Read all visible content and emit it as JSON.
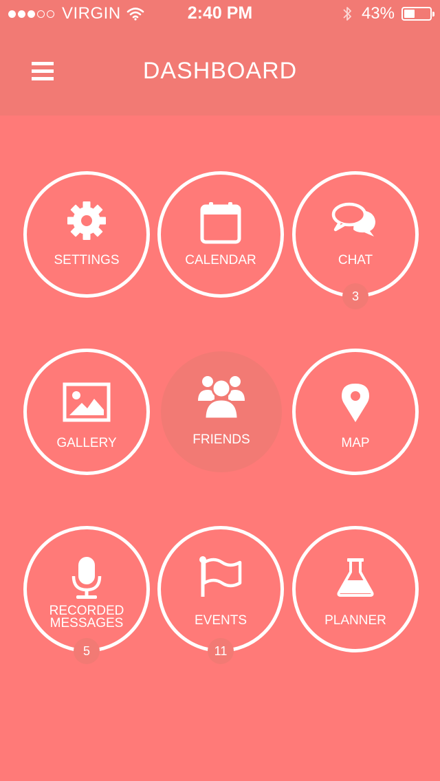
{
  "status_bar": {
    "carrier": "VIRGIN",
    "time": "2:40 PM",
    "battery_percent": "43%",
    "battery_level": 0.43,
    "signal_bars": 3
  },
  "header": {
    "title": "DASHBOARD",
    "menu_icon": "hamburger-menu-icon"
  },
  "colors": {
    "background": "#ff7a78",
    "header": "#f27a74",
    "badge": "#f27a74",
    "foreground": "#ffffff"
  },
  "tiles": [
    {
      "label": "SETTINGS",
      "icon": "gear-icon"
    },
    {
      "label": "CALENDAR",
      "icon": "calendar-icon"
    },
    {
      "label": "CHAT",
      "icon": "chat-bubbles-icon",
      "badge": "3"
    },
    {
      "label": "GALLERY",
      "icon": "image-icon"
    },
    {
      "label": "FRIENDS",
      "icon": "users-icon",
      "active": true
    },
    {
      "label": "MAP",
      "icon": "map-pin-icon"
    },
    {
      "label_line1": "RECORDED",
      "label_line2": "MESSAGES",
      "icon": "microphone-icon",
      "badge": "5"
    },
    {
      "label": "EVENTS",
      "icon": "flag-icon",
      "badge": "11"
    },
    {
      "label": "PLANNER",
      "icon": "flask-icon"
    }
  ]
}
